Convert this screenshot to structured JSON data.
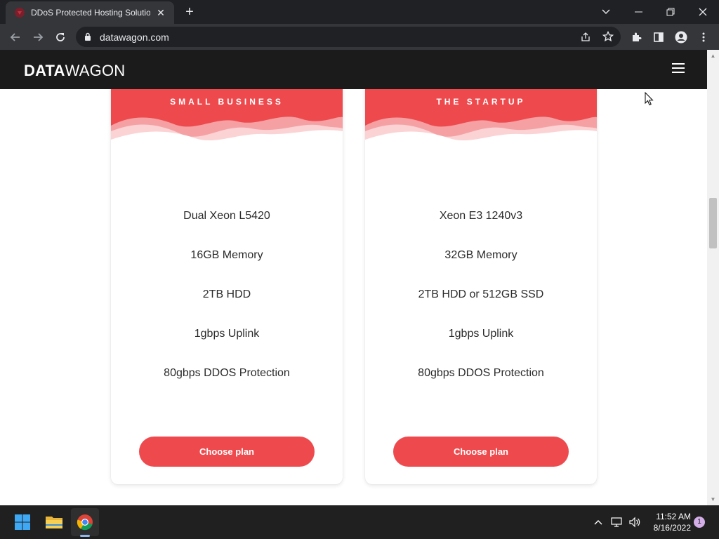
{
  "browser": {
    "tab_title": "DDoS Protected Hosting Solution",
    "tab_close": "✕",
    "new_tab": "+",
    "url": "datawagon.com"
  },
  "site": {
    "logo_bold": "DATA",
    "logo_light": "WAGON"
  },
  "plans": [
    {
      "name": "SMALL BUSINESS",
      "features": [
        "Dual Xeon L5420",
        "16GB Memory",
        "2TB HDD",
        "1gbps Uplink",
        "80gbps DDOS Protection"
      ],
      "button": "Choose plan"
    },
    {
      "name": "THE STARTUP",
      "features": [
        "Xeon E3 1240v3",
        "32GB Memory",
        "2TB HDD or 512GB SSD",
        "1gbps Uplink",
        "80gbps DDOS Protection"
      ],
      "button": "Choose plan"
    }
  ],
  "taskbar": {
    "time": "11:52 AM",
    "date": "8/16/2022",
    "notification_count": "1"
  },
  "colors": {
    "accent": "#ee4a4e",
    "header_bg": "#1b1b1b",
    "chrome_dark": "#202124",
    "chrome_toolbar": "#35363a"
  },
  "icons": [
    "back-arrow-icon",
    "forward-arrow-icon",
    "reload-icon",
    "lock-icon",
    "share-icon",
    "bookmark-star-icon",
    "extensions-icon",
    "side-panel-icon",
    "profile-icon",
    "kebab-menu-icon",
    "hamburger-menu-icon",
    "windows-start-icon",
    "file-explorer-icon",
    "chrome-icon",
    "chevron-up-icon",
    "network-icon",
    "volume-icon"
  ]
}
